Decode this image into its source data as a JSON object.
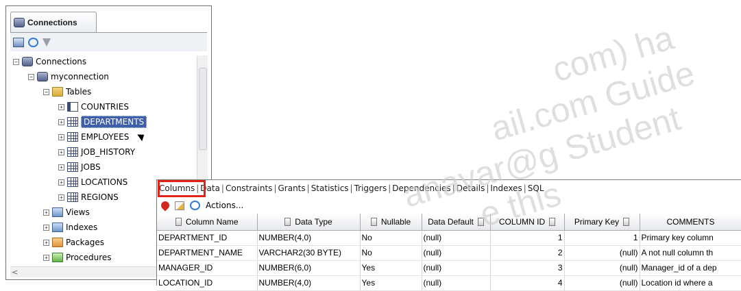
{
  "watermark": {
    "line1": "com) ha",
    "line2": "ail.com Guide",
    "line3": "anavar@g Student",
    "line4": "e this"
  },
  "connections_panel": {
    "tab_title": "Connections",
    "toolbar": [
      "new-connection-icon",
      "refresh-icon",
      "filter-icon"
    ],
    "tree": {
      "root": "Connections",
      "connection": "myconnection",
      "tables_folder": "Tables",
      "tables": [
        "COUNTRIES",
        "DEPARTMENTS",
        "EMPLOYEES",
        "JOB_HISTORY",
        "JOBS",
        "LOCATIONS",
        "REGIONS"
      ],
      "selected_table": "DEPARTMENTS",
      "other_folders": [
        "Views",
        "Indexes",
        "Packages",
        "Procedures"
      ]
    }
  },
  "details": {
    "tabs": [
      "Columns",
      "Data",
      "Constraints",
      "Grants",
      "Statistics",
      "Triggers",
      "Dependencies",
      "Details",
      "Indexes",
      "SQL"
    ],
    "active_tab": "Columns",
    "actions_label": "Actions...",
    "grid": {
      "headers": [
        "Column Name",
        "Data Type",
        "Nullable",
        "Data Default",
        "COLUMN ID",
        "Primary Key",
        "COMMENTS"
      ],
      "rows": [
        [
          "DEPARTMENT_ID",
          "NUMBER(4,0)",
          "No",
          "(null)",
          "1",
          "1",
          "Primary key column"
        ],
        [
          "DEPARTMENT_NAME",
          "VARCHAR2(30 BYTE)",
          "No",
          "(null)",
          "2",
          "(null)",
          "A not null column th"
        ],
        [
          "MANAGER_ID",
          "NUMBER(6,0)",
          "Yes",
          "(null)",
          "3",
          "(null)",
          "Manager_id of a dep"
        ],
        [
          "LOCATION_ID",
          "NUMBER(4,0)",
          "Yes",
          "(null)",
          "4",
          "(null)",
          "Location id where a"
        ]
      ]
    }
  }
}
